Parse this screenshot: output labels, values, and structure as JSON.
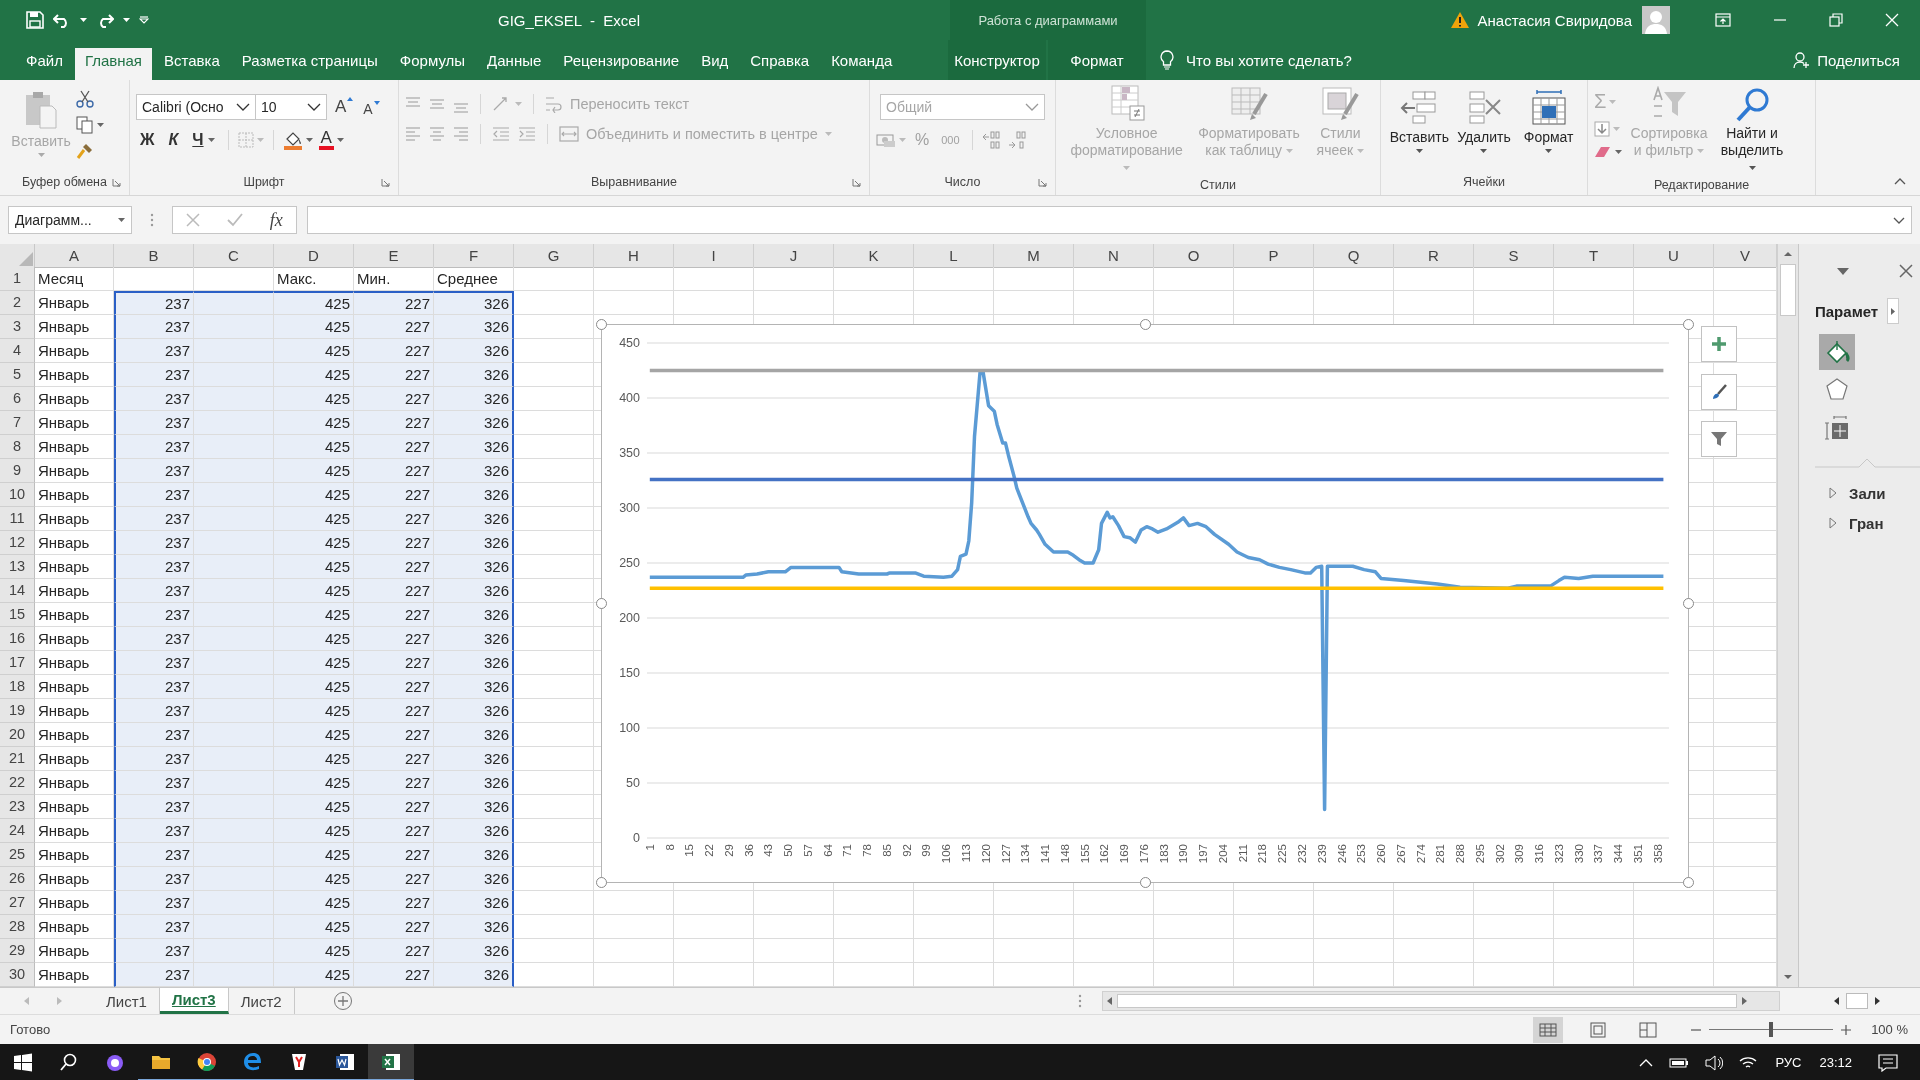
{
  "title_bar": {
    "title": "GIG_EKSEL  -  Excel",
    "context_label": "Работа с диаграммами",
    "user_name": "Анастасия Свиридова"
  },
  "ribbon_tabs": [
    {
      "label": "Файл",
      "selected": false,
      "contextual": false
    },
    {
      "label": "Главная",
      "selected": true,
      "contextual": false
    },
    {
      "label": "Вставка",
      "selected": false,
      "contextual": false
    },
    {
      "label": "Разметка страницы",
      "selected": false,
      "contextual": false
    },
    {
      "label": "Формулы",
      "selected": false,
      "contextual": false
    },
    {
      "label": "Данные",
      "selected": false,
      "contextual": false
    },
    {
      "label": "Рецензирование",
      "selected": false,
      "contextual": false
    },
    {
      "label": "Вид",
      "selected": false,
      "contextual": false
    },
    {
      "label": "Справка",
      "selected": false,
      "contextual": false
    },
    {
      "label": "Команда",
      "selected": false,
      "contextual": false
    },
    {
      "label": "Конструктор",
      "selected": false,
      "contextual": true
    },
    {
      "label": "Формат",
      "selected": false,
      "contextual": true
    }
  ],
  "tell_me": "Что вы хотите сделать?",
  "share": "Поделиться",
  "ribbon": {
    "clipboard": {
      "paste": {
        "label": "Вставить",
        "disabled": true
      },
      "group_label": "Буфер обмена"
    },
    "font": {
      "font_name": "Calibri (Осно",
      "font_size": "10",
      "grow": "A",
      "shrink": "A",
      "bold": "Ж",
      "italic": "К",
      "underline": "Ч",
      "font_color": "A",
      "group_label": "Шрифт"
    },
    "alignment": {
      "wrap_text": {
        "label": "Переносить текст",
        "disabled": true
      },
      "merge": {
        "label": "Объединить и поместить в центре",
        "disabled": true
      },
      "group_label": "Выравнивание"
    },
    "number": {
      "format": {
        "value": "Общий",
        "disabled": true
      },
      "percent": "%",
      "thousands": "000",
      "group_label": "Число"
    },
    "styles": {
      "buttons": [
        {
          "label": "Условное форматирование",
          "disabled": true
        },
        {
          "label": "Форматировать как таблицу",
          "disabled": true
        },
        {
          "label": "Стили ячеек",
          "disabled": true
        }
      ],
      "group_label": "Стили"
    },
    "cells": {
      "buttons": [
        {
          "label": "Вставить",
          "disabled": false
        },
        {
          "label": "Удалить",
          "disabled": false
        },
        {
          "label": "Формат",
          "disabled": false
        }
      ],
      "group_label": "Ячейки"
    },
    "editing": {
      "sum": "Σ",
      "buttons": [
        {
          "label": "Сортировка и фильтр",
          "disabled": true
        },
        {
          "label": "Найти и выделить",
          "disabled": false
        }
      ],
      "group_label": "Редактирование"
    }
  },
  "formula_bar": {
    "name_box": "Диаграмм...",
    "fx": "fx"
  },
  "sheet": {
    "columns": [
      "A",
      "B",
      "C",
      "D",
      "E",
      "F",
      "G",
      "H",
      "I",
      "J",
      "K",
      "L",
      "M",
      "N",
      "O",
      "P",
      "Q",
      "R",
      "S",
      "T",
      "U",
      "V"
    ],
    "rows": [
      {
        "number": "1",
        "kind": "header",
        "selected": false,
        "cells": {
          "a": "Месяц",
          "d": "Макс.",
          "e": "Мин.",
          "f": "Среднее"
        }
      },
      {
        "number": "2",
        "kind": "data",
        "selected": true,
        "cells": {
          "a": "Январь",
          "b": "237",
          "d": "425",
          "e": "227",
          "f": "326"
        }
      },
      {
        "number": "3",
        "kind": "data",
        "selected": true,
        "cells": {
          "a": "Январь",
          "b": "237",
          "d": "425",
          "e": "227",
          "f": "326"
        }
      },
      {
        "number": "4",
        "kind": "data",
        "selected": true,
        "cells": {
          "a": "Январь",
          "b": "237",
          "d": "425",
          "e": "227",
          "f": "326"
        }
      },
      {
        "number": "5",
        "kind": "data",
        "selected": true,
        "cells": {
          "a": "Январь",
          "b": "237",
          "d": "425",
          "e": "227",
          "f": "326"
        }
      },
      {
        "number": "6",
        "kind": "data",
        "selected": true,
        "cells": {
          "a": "Январь",
          "b": "237",
          "d": "425",
          "e": "227",
          "f": "326"
        }
      },
      {
        "number": "7",
        "kind": "data",
        "selected": true,
        "cells": {
          "a": "Январь",
          "b": "237",
          "d": "425",
          "e": "227",
          "f": "326"
        }
      },
      {
        "number": "8",
        "kind": "data",
        "selected": true,
        "cells": {
          "a": "Январь",
          "b": "237",
          "d": "425",
          "e": "227",
          "f": "326"
        }
      },
      {
        "number": "9",
        "kind": "data",
        "selected": true,
        "cells": {
          "a": "Январь",
          "b": "237",
          "d": "425",
          "e": "227",
          "f": "326"
        }
      },
      {
        "number": "10",
        "kind": "data",
        "selected": true,
        "cells": {
          "a": "Январь",
          "b": "237",
          "d": "425",
          "e": "227",
          "f": "326"
        }
      },
      {
        "number": "11",
        "kind": "data",
        "selected": true,
        "cells": {
          "a": "Январь",
          "b": "237",
          "d": "425",
          "e": "227",
          "f": "326"
        }
      },
      {
        "number": "12",
        "kind": "data",
        "selected": true,
        "cells": {
          "a": "Январь",
          "b": "237",
          "d": "425",
          "e": "227",
          "f": "326"
        }
      },
      {
        "number": "13",
        "kind": "data",
        "selected": true,
        "cells": {
          "a": "Январь",
          "b": "237",
          "d": "425",
          "e": "227",
          "f": "326"
        }
      },
      {
        "number": "14",
        "kind": "data",
        "selected": true,
        "cells": {
          "a": "Январь",
          "b": "237",
          "d": "425",
          "e": "227",
          "f": "326"
        }
      },
      {
        "number": "15",
        "kind": "data",
        "selected": true,
        "cells": {
          "a": "Январь",
          "b": "237",
          "d": "425",
          "e": "227",
          "f": "326"
        }
      },
      {
        "number": "16",
        "kind": "data",
        "selected": true,
        "cells": {
          "a": "Январь",
          "b": "237",
          "d": "425",
          "e": "227",
          "f": "326"
        }
      },
      {
        "number": "17",
        "kind": "data",
        "selected": true,
        "cells": {
          "a": "Январь",
          "b": "237",
          "d": "425",
          "e": "227",
          "f": "326"
        }
      },
      {
        "number": "18",
        "kind": "data",
        "selected": true,
        "cells": {
          "a": "Январь",
          "b": "237",
          "d": "425",
          "e": "227",
          "f": "326"
        }
      },
      {
        "number": "19",
        "kind": "data",
        "selected": true,
        "cells": {
          "a": "Январь",
          "b": "237",
          "d": "425",
          "e": "227",
          "f": "326"
        }
      },
      {
        "number": "20",
        "kind": "data",
        "selected": true,
        "cells": {
          "a": "Январь",
          "b": "237",
          "d": "425",
          "e": "227",
          "f": "326"
        }
      },
      {
        "number": "21",
        "kind": "data",
        "selected": true,
        "cells": {
          "a": "Январь",
          "b": "237",
          "d": "425",
          "e": "227",
          "f": "326"
        }
      },
      {
        "number": "22",
        "kind": "data",
        "selected": true,
        "cells": {
          "a": "Январь",
          "b": "237",
          "d": "425",
          "e": "227",
          "f": "326"
        }
      },
      {
        "number": "23",
        "kind": "data",
        "selected": true,
        "cells": {
          "a": "Январь",
          "b": "237",
          "d": "425",
          "e": "227",
          "f": "326"
        }
      },
      {
        "number": "24",
        "kind": "data",
        "selected": true,
        "cells": {
          "a": "Январь",
          "b": "237",
          "d": "425",
          "e": "227",
          "f": "326"
        }
      },
      {
        "number": "25",
        "kind": "data",
        "selected": true,
        "cells": {
          "a": "Январь",
          "b": "237",
          "d": "425",
          "e": "227",
          "f": "326"
        }
      },
      {
        "number": "26",
        "kind": "data",
        "selected": true,
        "cells": {
          "a": "Январь",
          "b": "237",
          "d": "425",
          "e": "227",
          "f": "326"
        }
      },
      {
        "number": "27",
        "kind": "data",
        "selected": true,
        "cells": {
          "a": "Январь",
          "b": "237",
          "d": "425",
          "e": "227",
          "f": "326"
        }
      },
      {
        "number": "28",
        "kind": "data",
        "selected": true,
        "cells": {
          "a": "Январь",
          "b": "237",
          "d": "425",
          "e": "227",
          "f": "326"
        }
      },
      {
        "number": "29",
        "kind": "data",
        "selected": true,
        "cells": {
          "a": "Январь",
          "b": "237",
          "d": "425",
          "e": "227",
          "f": "326"
        }
      },
      {
        "number": "30",
        "kind": "data",
        "selected": true,
        "cells": {
          "a": "Январь",
          "b": "237",
          "d": "425",
          "e": "227",
          "f": "326"
        }
      }
    ]
  },
  "chart": {
    "chart_data": {
      "type": "line",
      "x": [
        1,
        34,
        35,
        39,
        43,
        49,
        51,
        55,
        68,
        69,
        75,
        85,
        86,
        95,
        98,
        105,
        108,
        110,
        111,
        113,
        114,
        115,
        116,
        118,
        119,
        121,
        123,
        124,
        126,
        127,
        128,
        130,
        131,
        135,
        136,
        138,
        139,
        141,
        144,
        149,
        151,
        153,
        155,
        158,
        160,
        161,
        163,
        164,
        165,
        167,
        169,
        171,
        173,
        175,
        177,
        179,
        181,
        184,
        188,
        190,
        192,
        195,
        198,
        201,
        206,
        209,
        213,
        217,
        220,
        224,
        228,
        233,
        235,
        237,
        239,
        240,
        241,
        250,
        254,
        258,
        260,
        268,
        280,
        288,
        305,
        308,
        320,
        323,
        325,
        330,
        335,
        360
      ],
      "series": [
        {
          "color": "#5b9bd5",
          "values": [
            237,
            237,
            239,
            240,
            242,
            242,
            246,
            246,
            246,
            242,
            240,
            240,
            241,
            241,
            238,
            237,
            238,
            244,
            256,
            258,
            270,
            305,
            365,
            424,
            424,
            393,
            388,
            376,
            359,
            359,
            348,
            329,
            318,
            292,
            286,
            280,
            276,
            267,
            260,
            260,
            257,
            253,
            250,
            250,
            262,
            286,
            296,
            291,
            292,
            284,
            274,
            273,
            269,
            280,
            283,
            281,
            278,
            281,
            287,
            291,
            284,
            286,
            283,
            276,
            267,
            260,
            255,
            253,
            249,
            246,
            244,
            241,
            241,
            246,
            247,
            26,
            247,
            247,
            244,
            242,
            236,
            234,
            231,
            228,
            227,
            229,
            229,
            234,
            237,
            236,
            238,
            238
          ]
        },
        {
          "color": "#a5a5a5",
          "values": [
            425,
            425,
            425,
            425,
            425,
            425,
            425,
            425,
            425,
            425,
            425,
            425,
            425,
            425,
            425,
            425,
            425,
            425,
            425,
            425,
            425,
            425,
            425,
            425,
            425,
            425,
            425,
            425,
            425,
            425,
            425,
            425,
            425,
            425,
            425,
            425,
            425,
            425,
            425,
            425,
            425,
            425,
            425,
            425,
            425,
            425,
            425,
            425,
            425,
            425,
            425,
            425,
            425,
            425,
            425,
            425,
            425,
            425,
            425,
            425,
            425,
            425,
            425,
            425,
            425,
            425,
            425,
            425,
            425,
            425,
            425,
            425,
            425,
            425,
            425,
            425,
            425,
            425,
            425,
            425,
            425,
            425,
            425,
            425,
            425,
            425,
            425,
            425,
            425,
            425,
            425,
            425
          ]
        },
        {
          "color": "#ffc000",
          "values": [
            227,
            227,
            227,
            227,
            227,
            227,
            227,
            227,
            227,
            227,
            227,
            227,
            227,
            227,
            227,
            227,
            227,
            227,
            227,
            227,
            227,
            227,
            227,
            227,
            227,
            227,
            227,
            227,
            227,
            227,
            227,
            227,
            227,
            227,
            227,
            227,
            227,
            227,
            227,
            227,
            227,
            227,
            227,
            227,
            227,
            227,
            227,
            227,
            227,
            227,
            227,
            227,
            227,
            227,
            227,
            227,
            227,
            227,
            227,
            227,
            227,
            227,
            227,
            227,
            227,
            227,
            227,
            227,
            227,
            227,
            227,
            227,
            227,
            227,
            227,
            227,
            227,
            227,
            227,
            227,
            227,
            227,
            227,
            227,
            227,
            227,
            227,
            227,
            227,
            227,
            227,
            227
          ]
        },
        {
          "color": "#4472c4",
          "values": [
            326,
            326,
            326,
            326,
            326,
            326,
            326,
            326,
            326,
            326,
            326,
            326,
            326,
            326,
            326,
            326,
            326,
            326,
            326,
            326,
            326,
            326,
            326,
            326,
            326,
            326,
            326,
            326,
            326,
            326,
            326,
            326,
            326,
            326,
            326,
            326,
            326,
            326,
            326,
            326,
            326,
            326,
            326,
            326,
            326,
            326,
            326,
            326,
            326,
            326,
            326,
            326,
            326,
            326,
            326,
            326,
            326,
            326,
            326,
            326,
            326,
            326,
            326,
            326,
            326,
            326,
            326,
            326,
            326,
            326,
            326,
            326,
            326,
            326,
            326,
            326,
            326,
            326,
            326,
            326,
            326,
            326,
            326,
            326,
            326,
            326,
            326,
            326,
            326,
            326,
            326,
            326
          ]
        }
      ],
      "xlim": [
        0,
        362
      ],
      "ylim": [
        0,
        450
      ],
      "xticks": [
        1,
        8,
        15,
        22,
        29,
        36,
        43,
        50,
        57,
        64,
        71,
        78,
        85,
        92,
        99,
        106,
        113,
        120,
        127,
        134,
        141,
        148,
        155,
        162,
        169,
        176,
        183,
        190,
        197,
        204,
        211,
        218,
        225,
        232,
        239,
        246,
        253,
        260,
        267,
        274,
        281,
        288,
        295,
        302,
        309,
        316,
        323,
        330,
        337,
        344,
        351,
        358
      ],
      "yticks": [
        0,
        50,
        100,
        150,
        200,
        250,
        300,
        350,
        400,
        450
      ],
      "grid": true
    }
  },
  "format_pane": {
    "title": "Парамет",
    "icon_tabs": [
      {
        "selected": true
      },
      {
        "selected": false
      },
      {
        "selected": false
      }
    ],
    "sections": [
      {
        "label": "Зали",
        "expanded": false
      },
      {
        "label": "Гран",
        "expanded": false
      }
    ]
  },
  "sheet_tabs": [
    {
      "label": "Лист1",
      "selected": false
    },
    {
      "label": "Лист3",
      "selected": true
    },
    {
      "label": "Лист2",
      "selected": false
    }
  ],
  "status_bar": {
    "status": "Готово",
    "views": [
      {
        "selected": true
      },
      {
        "selected": false
      },
      {
        "selected": false
      }
    ],
    "zoom_slider": {
      "level": 0.5
    },
    "zoom": "100 %"
  },
  "taskbar": {
    "language": "РУС",
    "time": "23:12"
  }
}
